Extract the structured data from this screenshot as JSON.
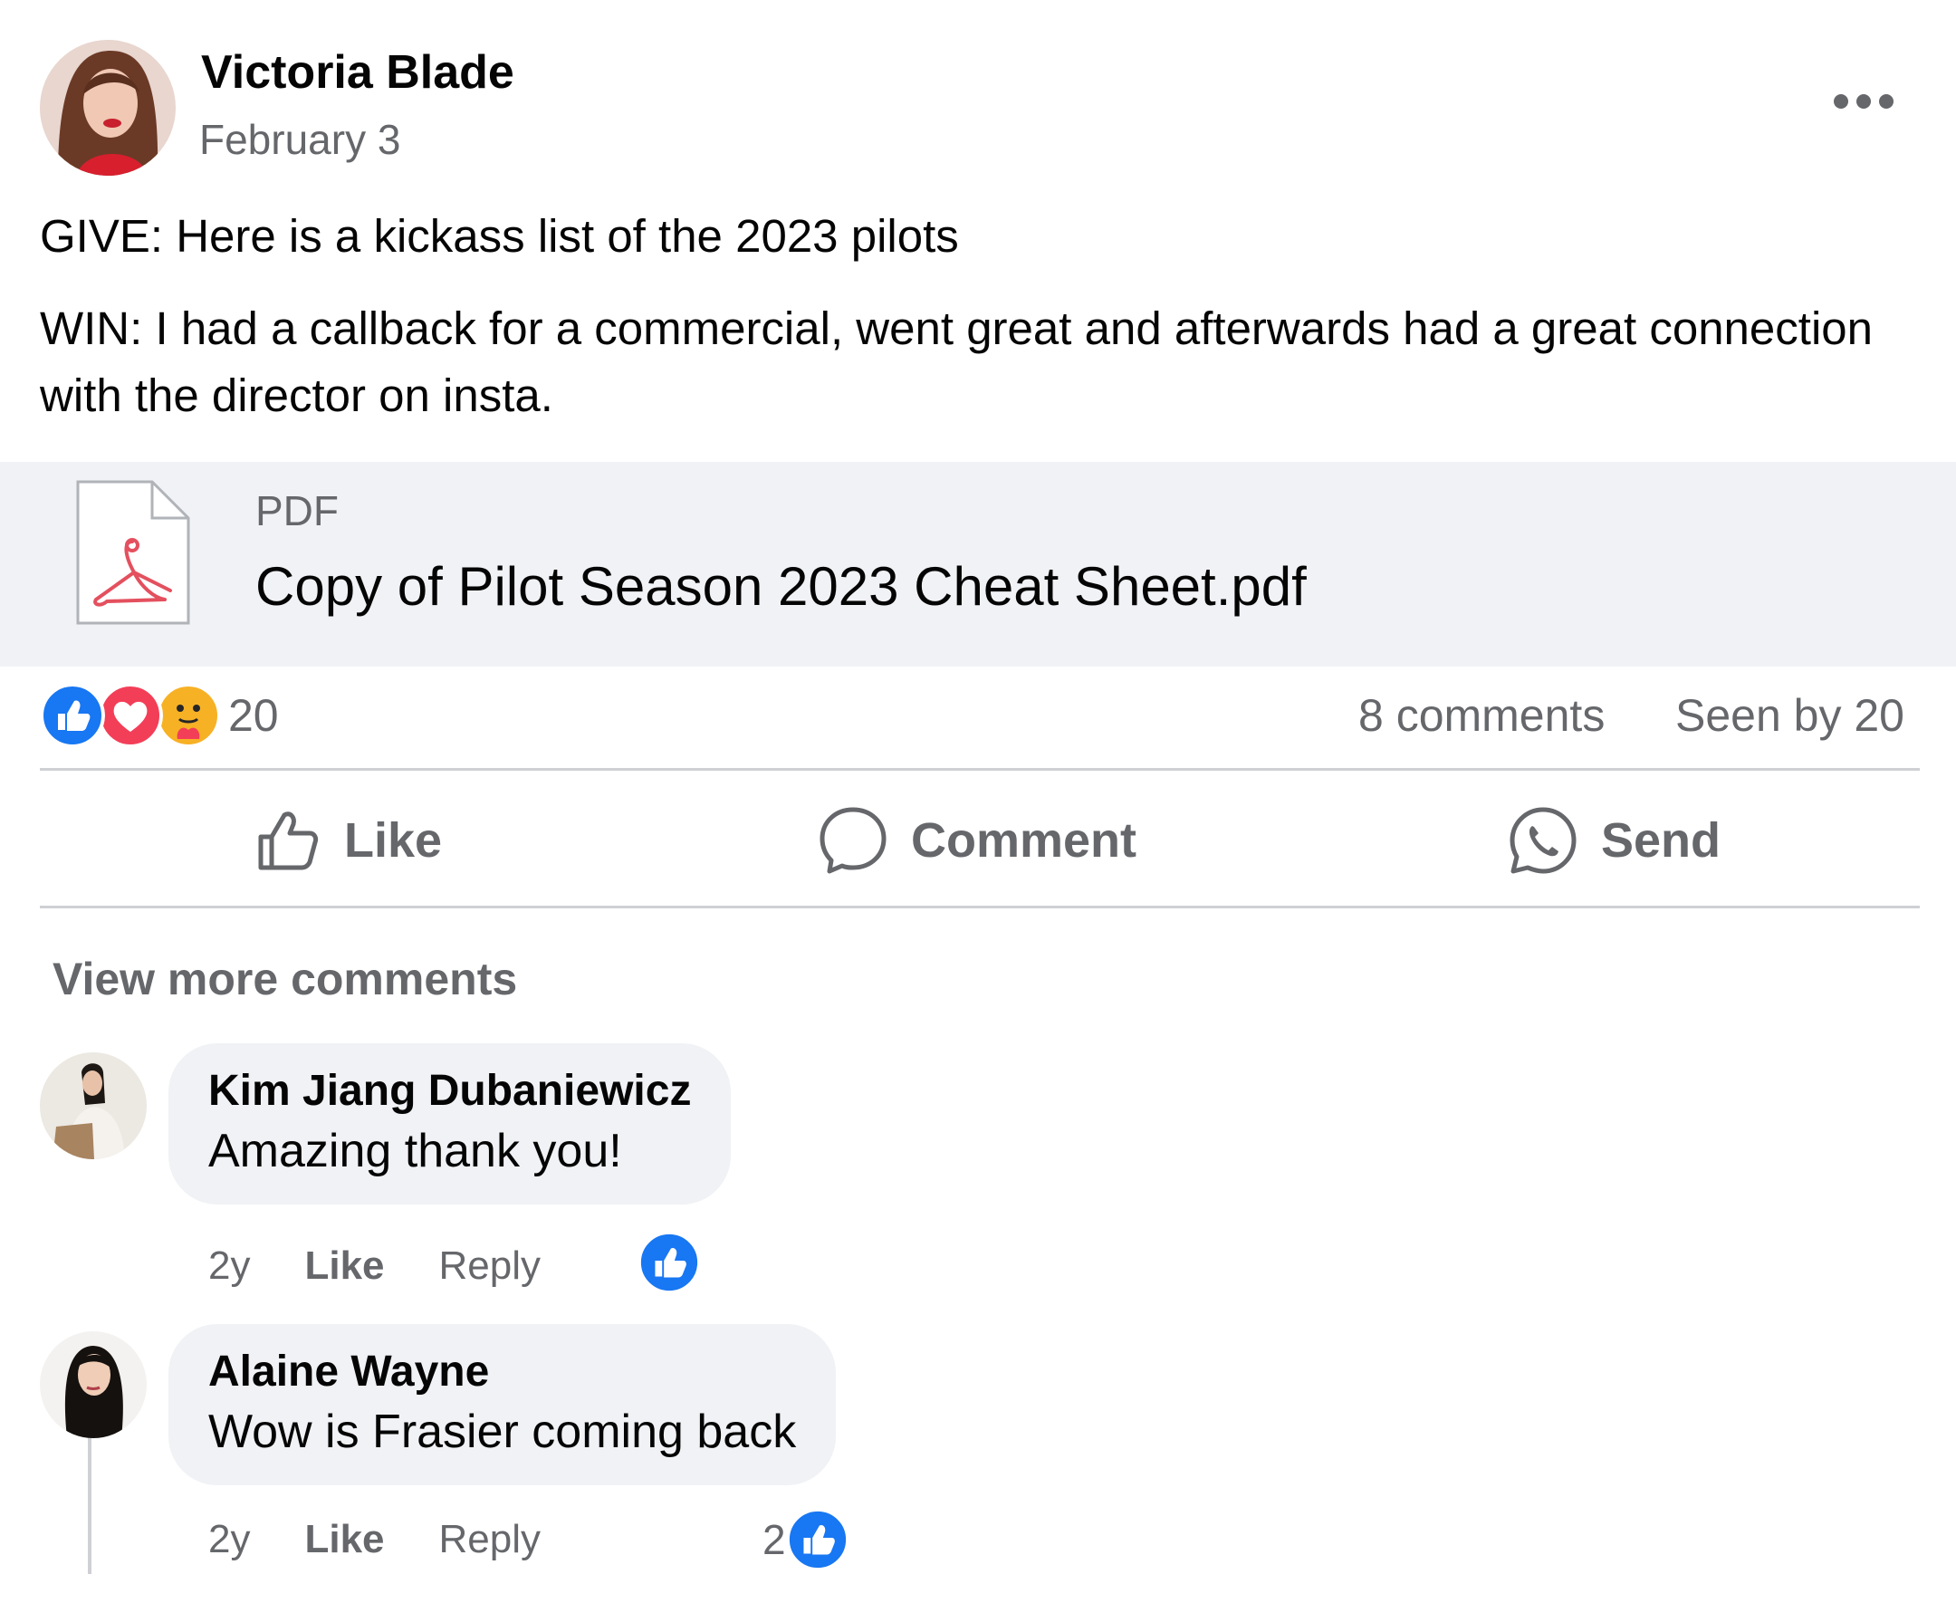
{
  "post": {
    "author": "Victoria Blade",
    "date": "February 3",
    "text_give": "GIVE: Here is a kickass list of the 2023 pilots",
    "text_win": "WIN: I had a callback for a commercial, went great and afterwards had a great connection with the director on insta.",
    "attachment": {
      "type_label": "PDF",
      "title": "Copy of Pilot Season 2023 Cheat Sheet.pdf",
      "icon": "pdf-file-icon"
    },
    "reactions": {
      "icons": [
        "like-reaction-icon",
        "love-reaction-icon",
        "care-reaction-icon"
      ],
      "count": "20"
    },
    "comments_count": "8 comments",
    "seen_by": "Seen by 20",
    "actions": {
      "like_label": "Like",
      "comment_label": "Comment",
      "send_label": "Send"
    }
  },
  "comments_section": {
    "view_more_label": "View more comments",
    "comments": [
      {
        "name": "Kim Jiang Dubaniewicz",
        "text": "Amazing thank you!",
        "time": "2y",
        "like_label": "Like",
        "reply_label": "Reply",
        "like_count": ""
      },
      {
        "name": "Alaine Wayne",
        "text": "Wow is Frasier coming back",
        "time": "2y",
        "like_label": "Like",
        "reply_label": "Reply",
        "like_count": "2"
      }
    ]
  },
  "colors": {
    "primary_text": "#050505",
    "secondary_text": "#65676b",
    "bubble_bg": "#f0f2f5",
    "like_blue": "#1877f2",
    "love_red": "#f33e58",
    "care_yellow": "#f7b125",
    "divider": "#ced0d4"
  }
}
